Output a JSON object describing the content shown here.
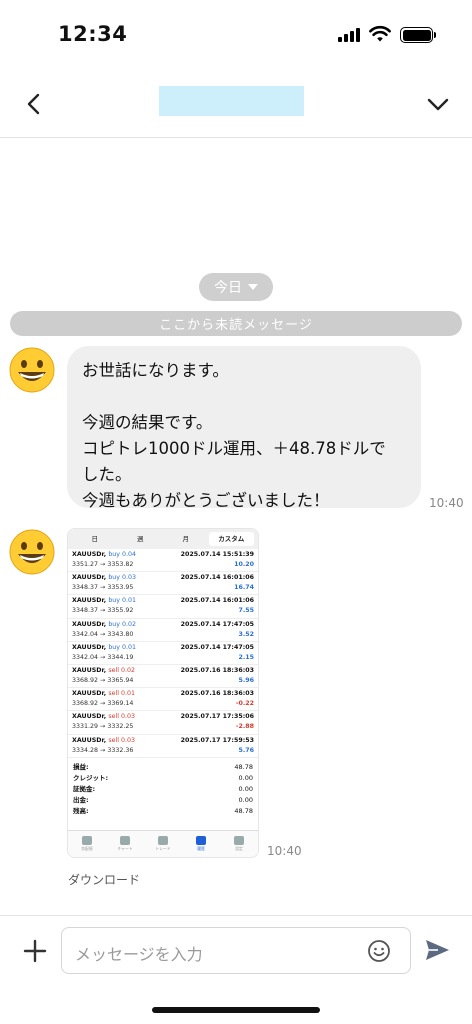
{
  "status_bar": {
    "time": "12:34"
  },
  "chat": {
    "date_label": "今日",
    "unread_divider": "ここから未読メッセージ",
    "message": {
      "lines": [
        "お世話になります。",
        "",
        "今週の結果です。",
        "コピトレ1000ドル運用、＋48.78ドルで",
        "した。",
        "今週もありがとうございました！"
      ],
      "time": "10:40"
    },
    "image_message": {
      "time": "10:40",
      "download_label": "ダウンロード",
      "tabs": [
        "日",
        "週",
        "月",
        "カスタム"
      ],
      "active_tab": "カスタム",
      "deals": [
        {
          "symbol": "XAUUSDr,",
          "side": "buy 0.04",
          "type": "buy",
          "datetime": "2025.07.14 15:51:39",
          "prices": "3351.27 → 3353.82",
          "profit": "10.20"
        },
        {
          "symbol": "XAUUSDr,",
          "side": "buy 0.03",
          "type": "buy",
          "datetime": "2025.07.14 16:01:06",
          "prices": "3348.37 → 3353.95",
          "profit": "16.74"
        },
        {
          "symbol": "XAUUSDr,",
          "side": "buy 0.01",
          "type": "buy",
          "datetime": "2025.07.14 16:01:06",
          "prices": "3348.37 → 3355.92",
          "profit": "7.55"
        },
        {
          "symbol": "XAUUSDr,",
          "side": "buy 0.02",
          "type": "buy",
          "datetime": "2025.07.14 17:47:05",
          "prices": "3342.04 → 3343.80",
          "profit": "3.52"
        },
        {
          "symbol": "XAUUSDr,",
          "side": "buy 0.01",
          "type": "buy",
          "datetime": "2025.07.14 17:47:05",
          "prices": "3342.04 → 3344.19",
          "profit": "2.15"
        },
        {
          "symbol": "XAUUSDr,",
          "side": "sell 0.02",
          "type": "sell",
          "datetime": "2025.07.16 18:36:03",
          "prices": "3368.92 → 3365.94",
          "profit": "5.96"
        },
        {
          "symbol": "XAUUSDr,",
          "side": "sell 0.01",
          "type": "sell",
          "datetime": "2025.07.16 18:36:03",
          "prices": "3368.92 → 3369.14",
          "profit": "-0.22"
        },
        {
          "symbol": "XAUUSDr,",
          "side": "sell 0.03",
          "type": "sell",
          "datetime": "2025.07.17 17:35:06",
          "prices": "3331.29 → 3332.25",
          "profit": "-2.88"
        },
        {
          "symbol": "XAUUSDr,",
          "side": "sell 0.03",
          "type": "sell",
          "datetime": "2025.07.17 17:59:53",
          "prices": "3334.28 → 3332.36",
          "profit": "5.76"
        }
      ],
      "summary": [
        {
          "label": "損益:",
          "value": "48.78"
        },
        {
          "label": "クレジット:",
          "value": "0.00"
        },
        {
          "label": "証拠金:",
          "value": "0.00"
        },
        {
          "label": "出金:",
          "value": "0.00"
        },
        {
          "label": "残高:",
          "value": "48.78"
        }
      ],
      "nav_items": [
        "気配値",
        "チャート",
        "トレード",
        "履歴",
        "設定"
      ],
      "nav_active": "履歴"
    }
  },
  "composer": {
    "placeholder": "メッセージを入力"
  },
  "colors": {
    "buy": "#2a6fd6",
    "sell": "#d63a2e",
    "bubble": "#efeff0",
    "title_redaction": "#cdeefb"
  }
}
